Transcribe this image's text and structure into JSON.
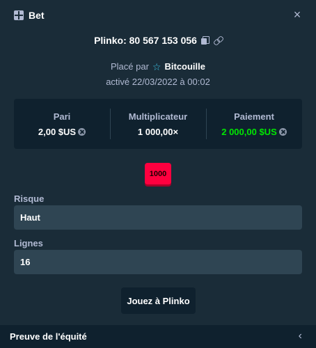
{
  "header": {
    "title": "Bet",
    "close_icon": "×"
  },
  "bet": {
    "game_label": "Plinko: 80 567 153 056",
    "placed_prefix": "Placé par",
    "user": "Bitcouille",
    "activated": "activé 22/03/2022 à 00:02"
  },
  "stats": {
    "bet_label": "Pari",
    "bet_value": "2,00 $US",
    "multiplier_label": "Multiplicateur",
    "multiplier_value": "1 000,00×",
    "payout_label": "Paiement",
    "payout_value": "2 000,00 $US"
  },
  "plinko": {
    "slot_value": "1000"
  },
  "form": {
    "risk_label": "Risque",
    "risk_value": "Haut",
    "lines_label": "Lignes",
    "lines_value": "16",
    "play_button": "Jouez à Plinko"
  },
  "footer": {
    "fairness": "Preuve de l'équité",
    "chevron": "‹"
  },
  "colors": {
    "background": "#1a2c38",
    "panel": "#0f212e",
    "input": "#2f4553",
    "payout_green": "#00e701",
    "slot_red": "#ff003f"
  }
}
